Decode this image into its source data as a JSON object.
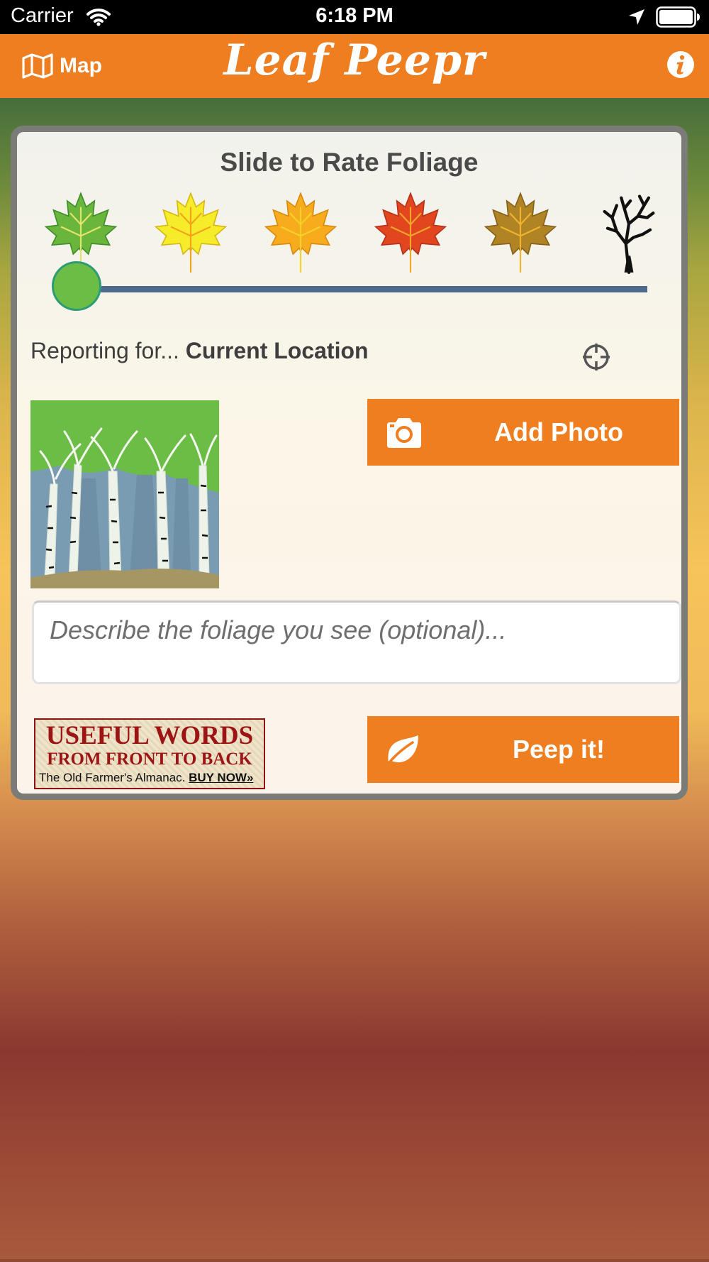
{
  "status_bar": {
    "carrier": "Carrier",
    "time": "6:18 PM",
    "icons": [
      "wifi-icon",
      "location-arrow-icon",
      "battery-icon"
    ]
  },
  "nav": {
    "map_label": "Map",
    "map_icon": "map-icon",
    "title": "Leaf Peepr",
    "info_icon": "info-icon"
  },
  "rating": {
    "title": "Slide to Rate Foliage",
    "levels": [
      "green-leaf-icon",
      "yellow-leaf-icon",
      "orange-leaf-icon",
      "red-leaf-icon",
      "brown-leaf-icon",
      "bare-tree-icon"
    ],
    "selected_index": 0,
    "slider_value": 0
  },
  "location": {
    "prefix": "Reporting for...",
    "name": "Current Location",
    "locate_icon": "crosshair-icon"
  },
  "photo": {
    "button_label": "Add Photo",
    "button_icon": "camera-icon",
    "thumbnail": "birch-trees-image"
  },
  "description": {
    "placeholder": "Describe the foliage you see (optional)...",
    "value": ""
  },
  "ad": {
    "line1": "USEFUL WORDS",
    "line2": "FROM FRONT TO BACK",
    "line3": "The Old Farmer's Almanac.",
    "cta": "BUY NOW»"
  },
  "submit": {
    "label": "Peep it!",
    "icon": "leaf-icon"
  },
  "colors": {
    "accent": "#ee7e1f",
    "slider_track": "#4c6a8c",
    "slider_thumb": "#6cbd45",
    "card_border": "#7b7b78"
  }
}
